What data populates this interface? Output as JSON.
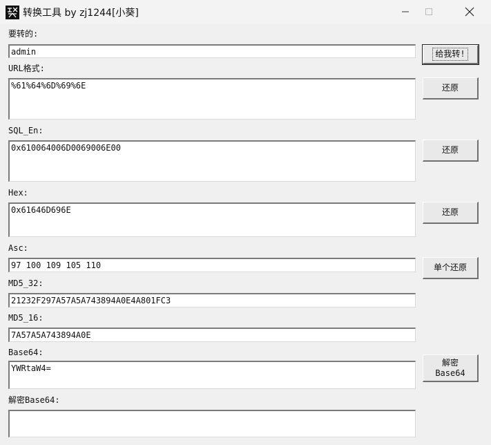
{
  "window": {
    "title": "转换工具 by zj1244[小葵]",
    "icon": "app-logo-icon"
  },
  "fields": {
    "input": {
      "label": "要转的:",
      "value": "admin"
    },
    "url": {
      "label": "URL格式:",
      "value": "%61%64%6D%69%6E"
    },
    "sql": {
      "label": "SQL_En:",
      "value": "0x610064006D0069006E00"
    },
    "hex": {
      "label": "Hex:",
      "value": "0x61646D696E"
    },
    "asc": {
      "label": "Asc:",
      "value": "97 100 109 105 110"
    },
    "md5_32": {
      "label": "MD5_32:",
      "value": "21232F297A57A5A743894A0E4A801FC3"
    },
    "md5_16": {
      "label": "MD5_16:",
      "value": "7A57A5A743894A0E"
    },
    "base64": {
      "label": "Base64:",
      "value": "YWRtaW4="
    },
    "decode_base64": {
      "label": "解密Base64:",
      "value": ""
    }
  },
  "buttons": {
    "convert": "给我转!",
    "url_restore": "还原",
    "sql_restore": "还原",
    "hex_restore": "还原",
    "asc_restore": "单个还原",
    "base64_decode": "解密\nBase64"
  }
}
